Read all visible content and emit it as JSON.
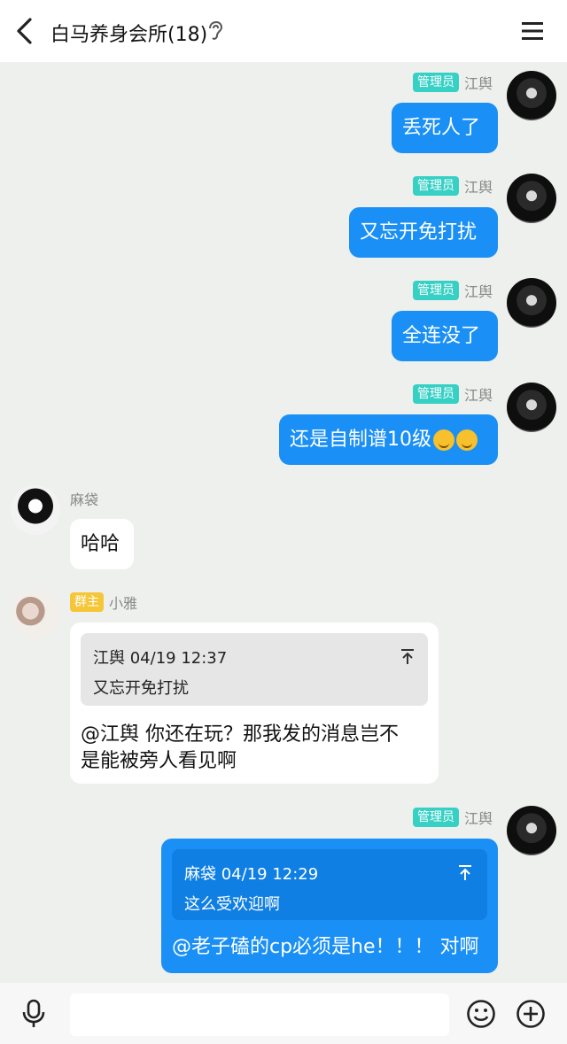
{
  "header": {
    "title": "白马养身会所(18)",
    "icons": {
      "back": "chevron-left-icon",
      "ear": "ear-icon",
      "menu": "hamburger-menu-icon"
    }
  },
  "colors": {
    "blue_bubble": "#1a8ff5",
    "admin_badge": "#36d0c4",
    "owner_badge": "#f5c637",
    "chat_bg": "#eef0ed"
  },
  "messages": [
    {
      "side": "right",
      "badge": "管理员",
      "sender": "江舆",
      "text": "丢死人了"
    },
    {
      "side": "right",
      "badge": "管理员",
      "sender": "江舆",
      "text": "又忘开免打扰"
    },
    {
      "side": "right",
      "badge": "管理员",
      "sender": "江舆",
      "text": "全连没了"
    },
    {
      "side": "right",
      "badge": "管理员",
      "sender": "江舆",
      "text": "还是自制谱10级",
      "emojis": [
        "sweat-smile-emoji",
        "sweat-smile-emoji"
      ]
    },
    {
      "side": "left",
      "sender": "麻袋",
      "text": "哈哈"
    },
    {
      "side": "left",
      "badge": "群主",
      "sender": "小雅",
      "quote": {
        "header": "江舆 04/19 12:37",
        "text": "又忘开免打扰"
      },
      "lines": [
        "@江舆 你还在玩？那我发的消息岂不",
        "是能被旁人看见啊"
      ]
    },
    {
      "side": "right",
      "badge": "管理员",
      "sender": "江舆",
      "quote": {
        "header": "麻袋 04/19 12:29",
        "text": "这么受欢迎啊"
      },
      "text": "@老子磕的cp必须是he！！！ 对啊"
    }
  ],
  "input_bar": {
    "placeholder": "",
    "icons": {
      "mic": "microphone-icon",
      "emoji": "smiley-icon",
      "plus": "plus-circle-icon"
    }
  }
}
